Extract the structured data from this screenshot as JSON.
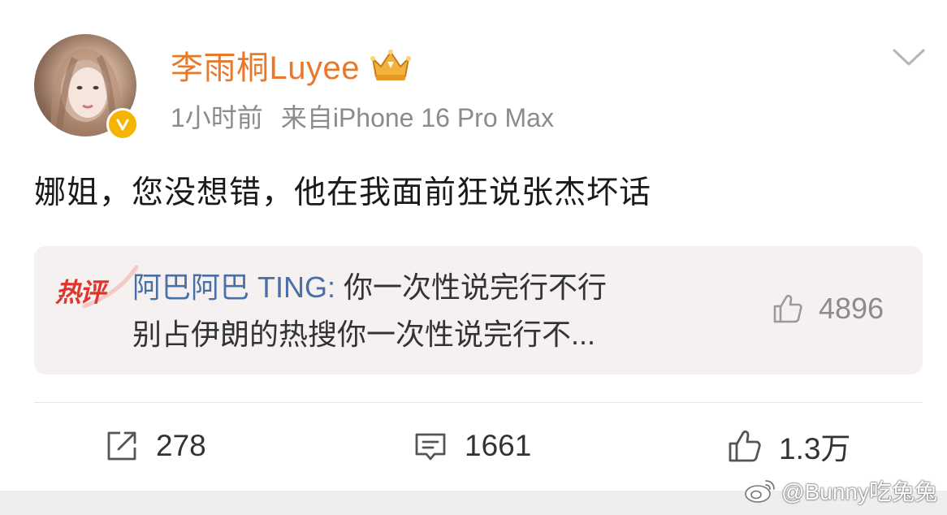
{
  "post": {
    "username": "李雨桐Luyee",
    "time": "1小时前",
    "source": "来自iPhone 16 Pro Max",
    "text": "娜姐，您没想错，他在我面前狂说张杰坏话"
  },
  "hot_comment": {
    "tag": "热评",
    "commenter": "阿巴阿巴 TING",
    "separator": ": ",
    "line1": "你一次性说完行不行",
    "line2": "别占伊朗的热搜你一次性说完行不...",
    "likes": "4896"
  },
  "actions": {
    "share_count": "278",
    "comment_count": "1661",
    "like_count": "1.3万"
  },
  "watermark": "@Bunny吃兔兔",
  "colors": {
    "username": "#e8792b",
    "commenter": "#4a6fa5",
    "hot_tag": "#e0342c",
    "verified_badge": "#f5b400"
  },
  "icons": {
    "verified": "verified-v-icon",
    "crown": "crown-badge-icon",
    "menu": "chevron-down-icon",
    "share": "share-icon",
    "comment": "comment-icon",
    "like": "thumbs-up-icon",
    "watermark_logo": "weibo-logo-icon"
  }
}
